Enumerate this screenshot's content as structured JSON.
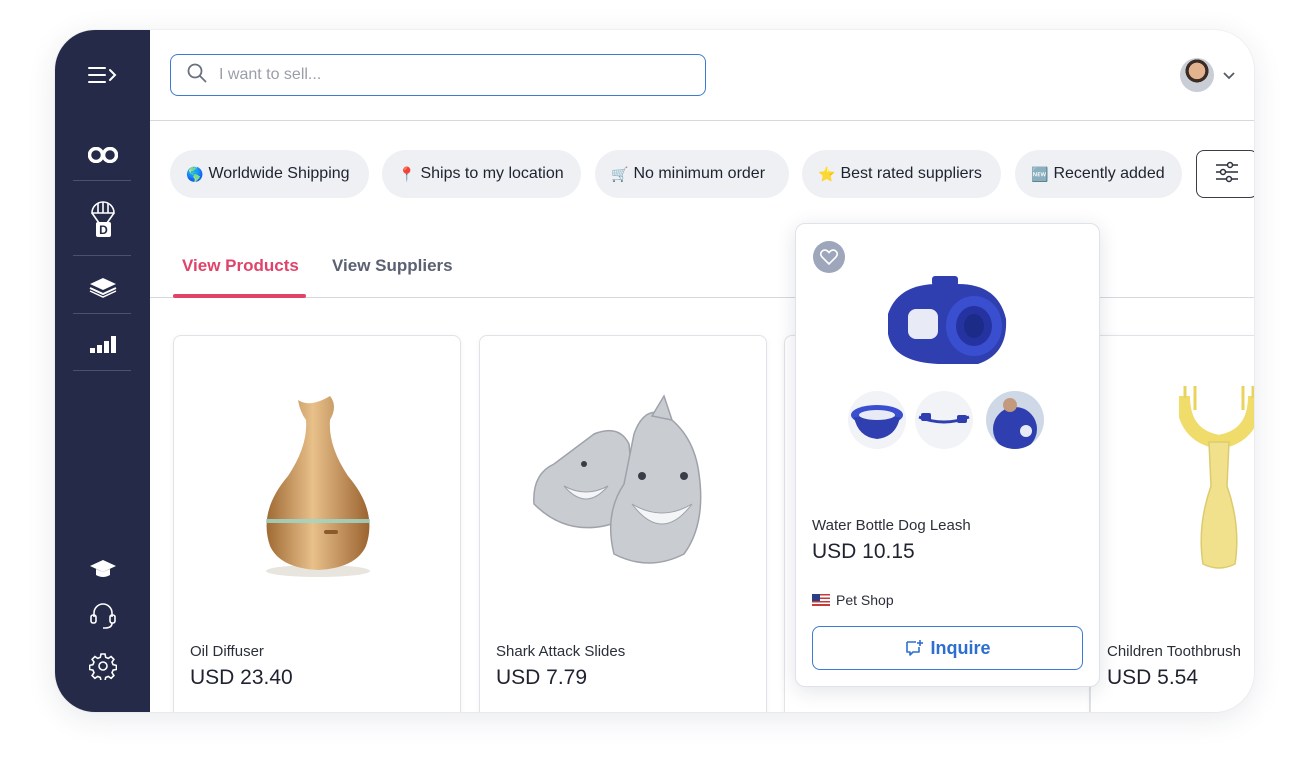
{
  "search": {
    "placeholder": "I want to sell..."
  },
  "filters": [
    {
      "emoji": "🌎",
      "label": "Worldwide Shipping"
    },
    {
      "emoji": "📍",
      "label": "Ships to my location"
    },
    {
      "emoji": "🛒",
      "label": "No minimum order"
    },
    {
      "emoji": "⭐",
      "label": "Best rated suppliers"
    },
    {
      "emoji": "🆕",
      "label": "Recently added"
    }
  ],
  "tabs": [
    {
      "label": "View Products",
      "active": true
    },
    {
      "label": "View Suppliers",
      "active": false
    }
  ],
  "products": [
    {
      "name": "Oil Diffuser",
      "price": "USD 23.40"
    },
    {
      "name": "Shark Attack Slides",
      "price": "USD 7.79"
    },
    {
      "name": "Children Toothbrush",
      "price": "USD 5.54"
    }
  ],
  "popup": {
    "name": "Water Bottle Dog Leash",
    "price": "USD 10.15",
    "shop": "Pet Shop",
    "inquire_label": "Inquire"
  },
  "colors": {
    "sidebar": "#242a47",
    "accent": "#e0436a",
    "link": "#2c6fd0"
  },
  "icons": {
    "sidebar_top": [
      "menu-expand-icon",
      "infinity-icon",
      "parachute-icon",
      "layers-icon",
      "signal-bars-icon"
    ],
    "sidebar_bottom": [
      "graduation-cap-icon",
      "headset-icon",
      "gear-icon"
    ]
  }
}
